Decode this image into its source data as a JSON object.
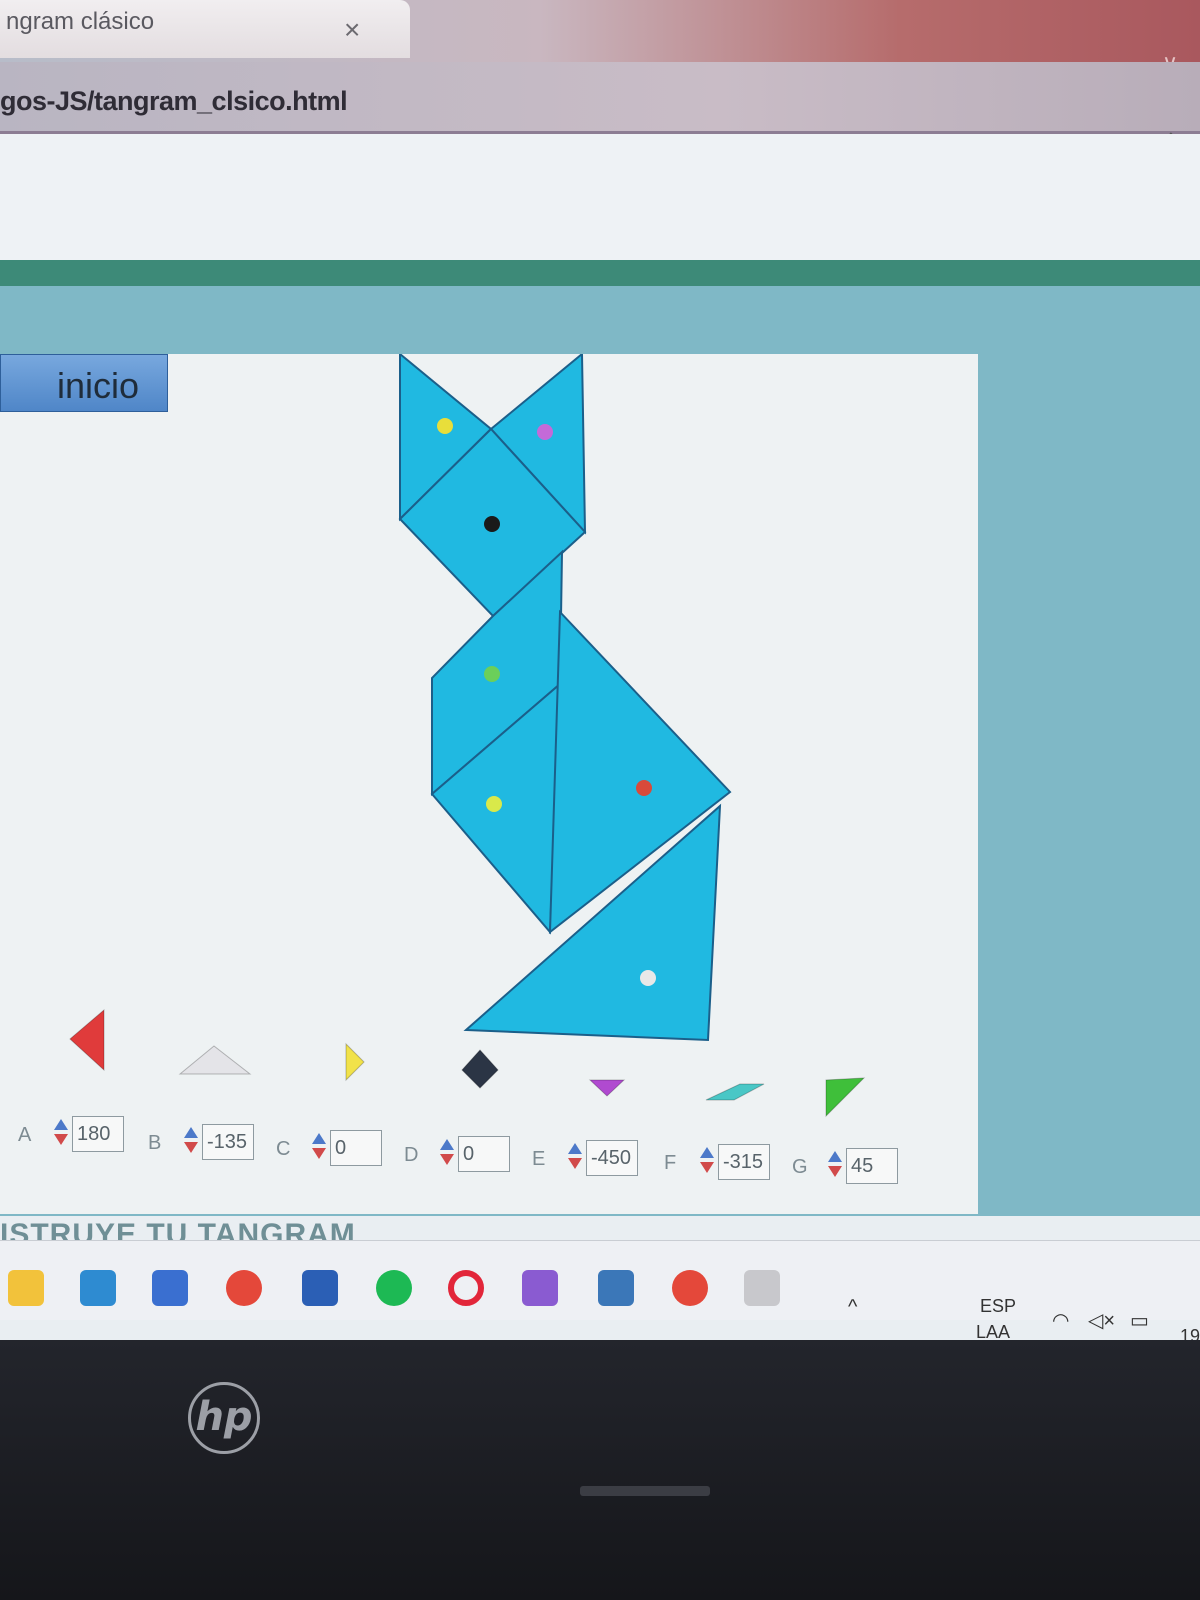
{
  "browser": {
    "tab_title": "ngram clásico",
    "tab_close": "×",
    "url": "gos-JS/tangram_clsico.html"
  },
  "app": {
    "inicio_label": "inicio",
    "footer_heading": "ISTRUYE TU TANGRAM"
  },
  "tangram": {
    "piece_color": "#20b9e1",
    "figure": [
      {
        "name": "small-triangle-left",
        "dot": "#e8de3a"
      },
      {
        "name": "small-triangle-right",
        "dot": "#c46ad8"
      },
      {
        "name": "square-head",
        "dot": "#1a1a1a"
      },
      {
        "name": "parallelogram-neck",
        "dot": "#6bcf5a"
      },
      {
        "name": "medium-triangle-body",
        "dot": "#d9e94a"
      },
      {
        "name": "large-triangle-body",
        "dot": "#d84a3a"
      },
      {
        "name": "large-triangle-base",
        "dot": "#e8e8e8"
      }
    ],
    "palette": [
      {
        "name": "red-triangle",
        "color": "#e03b3b"
      },
      {
        "name": "white-triangle",
        "color": "#e4e4e8"
      },
      {
        "name": "yellow-triangle",
        "color": "#f1e24a"
      },
      {
        "name": "dark-square",
        "color": "#2b3545"
      },
      {
        "name": "purple-triangle",
        "color": "#b04ad0"
      },
      {
        "name": "teal-parallelogram",
        "color": "#49c7c6"
      },
      {
        "name": "green-triangle",
        "color": "#3fbf3a"
      }
    ]
  },
  "controls": [
    {
      "label": "A",
      "value": "180"
    },
    {
      "label": "B",
      "value": "-135"
    },
    {
      "label": "C",
      "value": "0"
    },
    {
      "label": "D",
      "value": "0"
    },
    {
      "label": "E",
      "value": "-450"
    },
    {
      "label": "F",
      "value": "-315"
    },
    {
      "label": "G",
      "value": "45"
    }
  ],
  "taskbar": {
    "apps": [
      "file-explorer-icon",
      "mail-icon",
      "store-icon",
      "chrome-icon",
      "word-icon",
      "spotify-icon",
      "opera-icon",
      "visual-studio-icon",
      "python-icon",
      "chrome-profile-icon",
      "installer-icon"
    ],
    "tray_chevron": "^",
    "language_1": "ESP",
    "language_2": "LAA",
    "clock": "19"
  },
  "device": {
    "logo": "hp"
  }
}
